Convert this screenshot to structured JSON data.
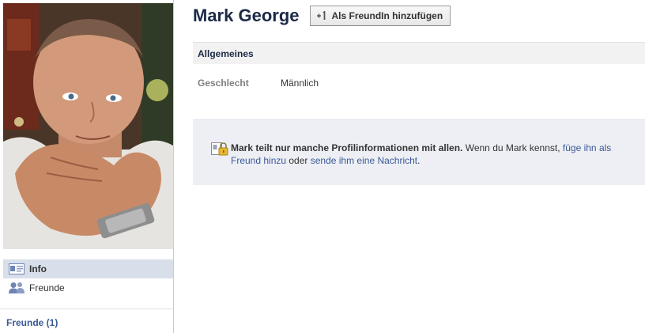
{
  "profile": {
    "name": "Mark George",
    "add_friend_label": "Als FreundIn hinzufügen"
  },
  "left_nav": {
    "items": [
      {
        "label": "Info",
        "icon": "info-card-icon",
        "active": true
      },
      {
        "label": "Freunde",
        "icon": "friends-icon",
        "active": false
      }
    ]
  },
  "friends_section": {
    "link_label": "Freunde (1)"
  },
  "general_section": {
    "title": "Allgemeines",
    "rows": [
      {
        "label": "Geschlecht",
        "value": "Männlich"
      }
    ]
  },
  "privacy_notice": {
    "icon": "lock-icon",
    "bold_text": "Mark teilt nur manche Profilinformationen mit allen.",
    "text_1": " Wenn du Mark kennst, ",
    "link_1": "füge ihn als Freund hinzu",
    "text_2": " oder ",
    "link_2": "sende ihm eine Nachricht",
    "text_3": "."
  },
  "colors": {
    "brand_blue": "#3b5998",
    "name_dark": "#1c2a47",
    "active_nav_bg": "#d8dfea",
    "privacy_bg": "#edeff4"
  }
}
